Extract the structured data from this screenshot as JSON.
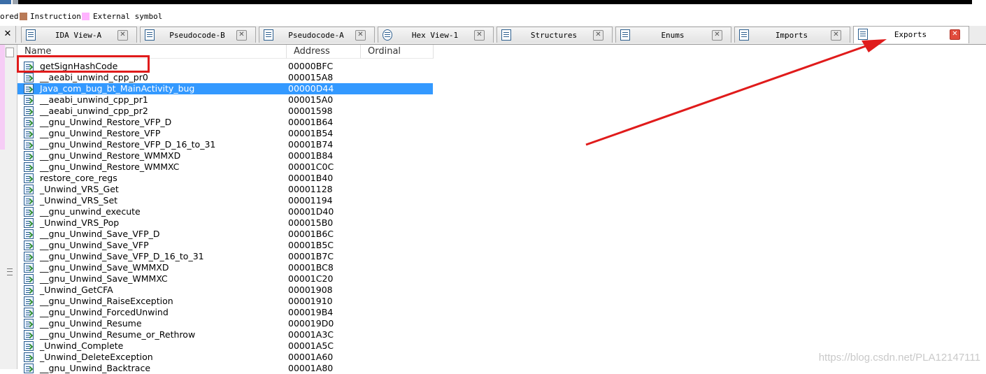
{
  "legend": {
    "items": [
      {
        "label": "ored",
        "color": ""
      },
      {
        "label": "Instruction",
        "color": "#b97a57"
      },
      {
        "label": "External symbol",
        "color": "#ffb3ff"
      }
    ]
  },
  "tabs": [
    {
      "label": "IDA View-A",
      "icon": "disassembly-icon",
      "active": false
    },
    {
      "label": "Pseudocode-B",
      "icon": "pseudocode-icon",
      "active": false
    },
    {
      "label": "Pseudocode-A",
      "icon": "pseudocode-icon",
      "active": false
    },
    {
      "label": "Hex View-1",
      "icon": "hex-icon",
      "active": false
    },
    {
      "label": "Structures",
      "icon": "structures-icon",
      "active": false
    },
    {
      "label": "Enums",
      "icon": "enums-icon",
      "active": false
    },
    {
      "label": "Imports",
      "icon": "imports-icon",
      "active": false
    },
    {
      "label": "Exports",
      "icon": "exports-icon",
      "active": true
    }
  ],
  "close_all_label": "✕",
  "table": {
    "columns": [
      "Name",
      "Address",
      "Ordinal"
    ],
    "rows": [
      {
        "name": "getSignHashCode",
        "address": "00000BFC"
      },
      {
        "name": "__aeabi_unwind_cpp_pr0",
        "address": "000015A8"
      },
      {
        "name": "Java_com_bug_bt_MainActivity_bug",
        "address": "00000D44",
        "selected": true
      },
      {
        "name": "__aeabi_unwind_cpp_pr1",
        "address": "000015A0"
      },
      {
        "name": "__aeabi_unwind_cpp_pr2",
        "address": "00001598"
      },
      {
        "name": "__gnu_Unwind_Restore_VFP_D",
        "address": "00001B64"
      },
      {
        "name": "__gnu_Unwind_Restore_VFP",
        "address": "00001B54"
      },
      {
        "name": "__gnu_Unwind_Restore_VFP_D_16_to_31",
        "address": "00001B74"
      },
      {
        "name": "__gnu_Unwind_Restore_WMMXD",
        "address": "00001B84"
      },
      {
        "name": "__gnu_Unwind_Restore_WMMXC",
        "address": "00001C0C"
      },
      {
        "name": "restore_core_regs",
        "address": "00001B40"
      },
      {
        "name": "_Unwind_VRS_Get",
        "address": "00001128"
      },
      {
        "name": "_Unwind_VRS_Set",
        "address": "00001194"
      },
      {
        "name": "__gnu_unwind_execute",
        "address": "00001D40"
      },
      {
        "name": "_Unwind_VRS_Pop",
        "address": "000015B0"
      },
      {
        "name": "__gnu_Unwind_Save_VFP_D",
        "address": "00001B6C"
      },
      {
        "name": "__gnu_Unwind_Save_VFP",
        "address": "00001B5C"
      },
      {
        "name": "__gnu_Unwind_Save_VFP_D_16_to_31",
        "address": "00001B7C"
      },
      {
        "name": "__gnu_Unwind_Save_WMMXD",
        "address": "00001BC8"
      },
      {
        "name": "__gnu_Unwind_Save_WMMXC",
        "address": "00001C20"
      },
      {
        "name": "_Unwind_GetCFA",
        "address": "00001908"
      },
      {
        "name": "__gnu_Unwind_RaiseException",
        "address": "00001910"
      },
      {
        "name": "__gnu_Unwind_ForcedUnwind",
        "address": "000019B4"
      },
      {
        "name": "__gnu_Unwind_Resume",
        "address": "000019D0"
      },
      {
        "name": "__gnu_Unwind_Resume_or_Rethrow",
        "address": "00001A3C"
      },
      {
        "name": "_Unwind_Complete",
        "address": "00001A5C"
      },
      {
        "name": "_Unwind_DeleteException",
        "address": "00001A60"
      },
      {
        "name": "__gnu_Unwind_Backtrace",
        "address": "00001A80"
      }
    ]
  },
  "watermark": "https://blog.csdn.net/PLA12147111",
  "colors": {
    "selection": "#3399ff",
    "annotation_red": "#e01b1b",
    "active_tab_close": "#e14b3c"
  }
}
